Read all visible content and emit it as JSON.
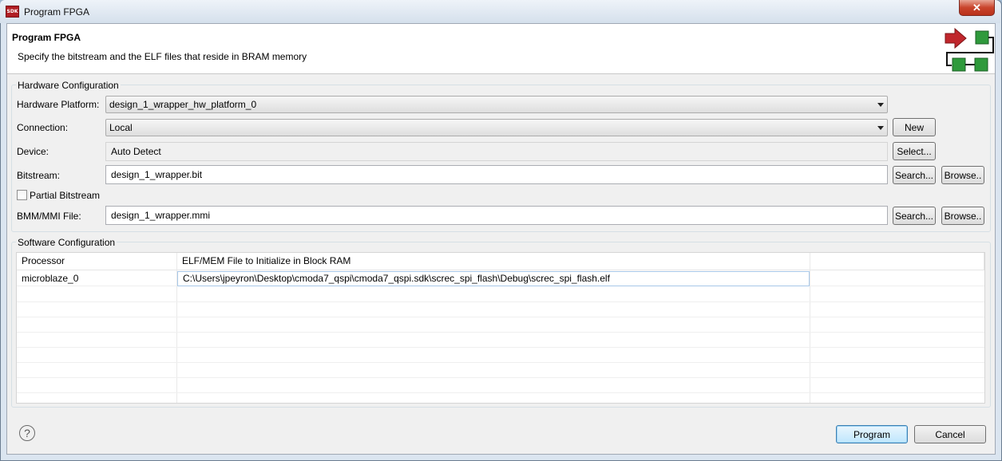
{
  "window": {
    "title": "Program FPGA",
    "icon_text": "SDK",
    "close_glyph": "✕"
  },
  "banner": {
    "title": "Program FPGA",
    "description": "Specify the bitstream and the ELF files that reside in BRAM memory"
  },
  "hardware": {
    "group_label": "Hardware Configuration",
    "platform_label": "Hardware Platform:",
    "platform_value": "design_1_wrapper_hw_platform_0",
    "connection_label": "Connection:",
    "connection_value": "Local",
    "new_button": "New",
    "device_label": "Device:",
    "device_value": "Auto Detect",
    "select_button": "Select...",
    "bitstream_label": "Bitstream:",
    "bitstream_value": "design_1_wrapper.bit",
    "search_button": "Search...",
    "browse_button": "Browse..",
    "partial_label": "Partial Bitstream",
    "partial_checked": false,
    "bmm_label": "BMM/MMI File:",
    "bmm_value": "design_1_wrapper.mmi"
  },
  "software": {
    "group_label": "Software Configuration",
    "columns": [
      "Processor",
      "ELF/MEM File to Initialize in Block RAM"
    ],
    "rows": [
      {
        "processor": "microblaze_0",
        "file": "C:\\Users\\jpeyron\\Desktop\\cmoda7_qspi\\cmoda7_qspi.sdk\\screc_spi_flash\\Debug\\screc_spi_flash.elf"
      }
    ]
  },
  "footer": {
    "help_glyph": "?",
    "program_button": "Program",
    "cancel_button": "Cancel"
  },
  "colors": {
    "title_bar": "#d5e0ec",
    "close": "#c9442c",
    "logo_red": "#c0262c",
    "logo_green": "#2f9a3c"
  }
}
